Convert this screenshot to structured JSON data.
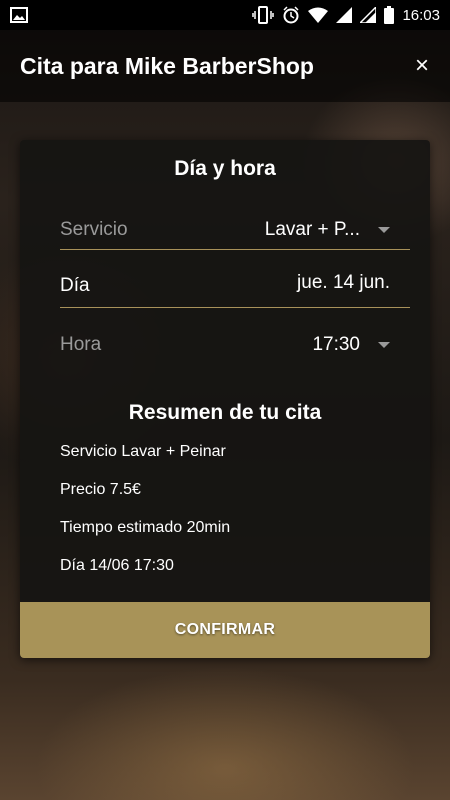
{
  "status_bar": {
    "time": "16:03"
  },
  "header": {
    "title": "Cita para Mike BarberShop",
    "close_symbol": "×"
  },
  "card": {
    "title": "Día y hora",
    "servicio": {
      "label": "Servicio",
      "value": "Lavar + P..."
    },
    "dia": {
      "label": "Día",
      "value": "jue. 14 jun."
    },
    "hora": {
      "label": "Hora",
      "value": "17:30"
    },
    "summary": {
      "title": "Resumen de tu cita",
      "servicio": "Servicio Lavar + Peinar",
      "precio": "Precio 7.5€",
      "tiempo": "Tiempo estimado 20min",
      "dia": "Día 14/06 17:30"
    },
    "confirm_label": "CONFIRMAR"
  },
  "colors": {
    "accent": "#a89358",
    "divider": "#a8915a"
  }
}
